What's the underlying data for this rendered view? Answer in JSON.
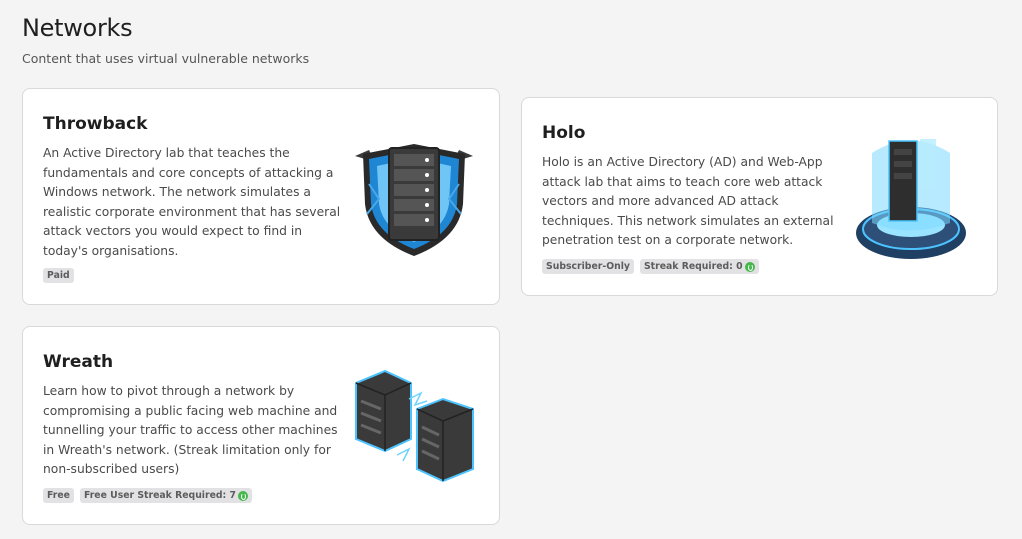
{
  "page": {
    "title": "Networks",
    "subtitle": "Content that uses virtual vulnerable networks"
  },
  "cards": [
    {
      "title": "Throwback",
      "description": "An Active Directory lab that teaches the fundamentals and core concepts of attacking a Windows network. The network simulates a realistic corporate environment that has several attack vectors you would expect to find in today's organisations.",
      "tags": [
        "Paid"
      ],
      "icon": "shield-server-icon"
    },
    {
      "title": "Holo",
      "description": "Holo is an Active Directory (AD) and Web-App attack lab that aims to teach core web attack vectors and more advanced AD attack techniques. This network simulates an external penetration test on a corporate network.",
      "tags": [
        "Subscriber-Only",
        "Streak Required: 0"
      ],
      "icon": "hologram-server-icon"
    },
    {
      "title": "Wreath",
      "description": "Learn how to pivot through a network by compromising a public facing web machine and tunnelling your traffic to access other machines in Wreath's network. (Streak limitation only for non-subscribed users)",
      "tags": [
        "Free",
        "Free User Streak Required: 7"
      ],
      "icon": "server-racks-icon"
    }
  ],
  "colors": {
    "accent_blue": "#2f8fd8",
    "streak_green": "#44b84a",
    "card_bg": "#ffffff",
    "page_bg": "#f4f4f5"
  }
}
